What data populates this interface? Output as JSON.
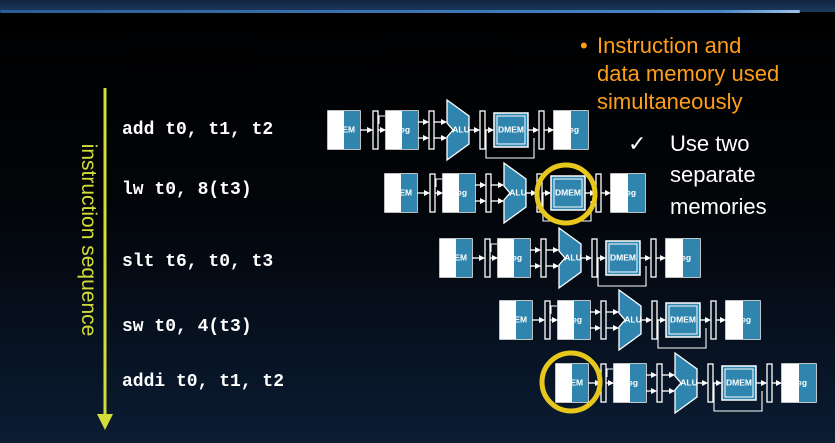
{
  "sequence_label": "instruction sequence",
  "instructions": [
    "add t0, t1, t2",
    "lw t0, 8(t3)",
    "slt t6, t0, t3",
    "sw t0, 4(t3)",
    "addi t0, t1, t2"
  ],
  "stages": {
    "imem": "IMEM",
    "reg": "Reg",
    "alu": "ALU",
    "dmem": "DMEM"
  },
  "note": {
    "lines": [
      "Instruction and",
      "data memory used",
      "simultaneously"
    ],
    "sub_lines": [
      "Use two",
      "separate",
      "memories"
    ]
  },
  "colors": {
    "note": "#ff9e1b",
    "label": "#d3dd3a",
    "stage_fill": "#2f85ad",
    "highlight": "#e8c71c"
  },
  "icons": {
    "bullet": "bullet-icon",
    "check": "check-icon",
    "arrow": "down-arrow-icon"
  }
}
